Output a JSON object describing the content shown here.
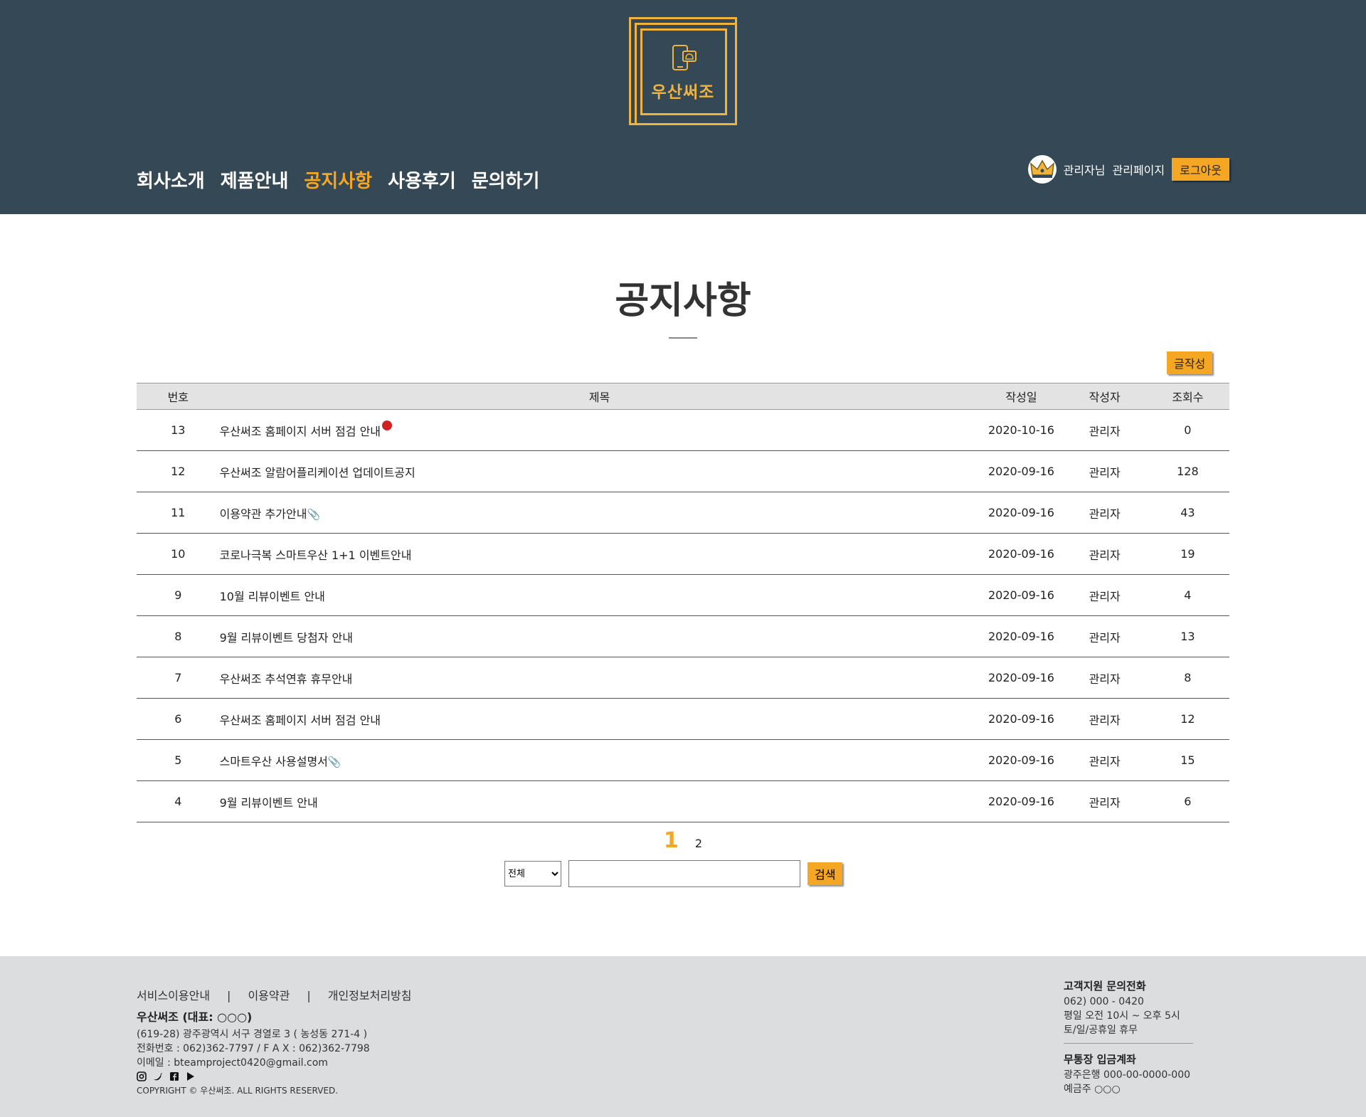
{
  "brand": {
    "name": "우산써조"
  },
  "nav": [
    {
      "label": "회사소개",
      "active": false
    },
    {
      "label": "제품안내",
      "active": false
    },
    {
      "label": "공지사항",
      "active": true
    },
    {
      "label": "사용후기",
      "active": false
    },
    {
      "label": "문의하기",
      "active": false
    }
  ],
  "user": {
    "greeting": "관리자님",
    "admin_link": "관리페이지",
    "logout": "로그아웃"
  },
  "page": {
    "title": "공지사항",
    "write_button": "글작성"
  },
  "table": {
    "headers": [
      "번호",
      "제목",
      "작성일",
      "작성자",
      "조회수"
    ],
    "rows": [
      {
        "no": "13",
        "title": "우산써조 홈페이지 서버 점검 안내",
        "badge": "hot",
        "date": "2020-10-16",
        "author": "관리자",
        "views": "0"
      },
      {
        "no": "12",
        "title": "우산써조 알람어플리케이션 업데이트공지",
        "badge": "",
        "date": "2020-09-16",
        "author": "관리자",
        "views": "128"
      },
      {
        "no": "11",
        "title": "이용약관 추가안내",
        "badge": "attachment",
        "date": "2020-09-16",
        "author": "관리자",
        "views": "43"
      },
      {
        "no": "10",
        "title": "코로나극복 스마트우산 1+1 이벤트안내",
        "badge": "",
        "date": "2020-09-16",
        "author": "관리자",
        "views": "19"
      },
      {
        "no": "9",
        "title": "10월 리뷰이벤트 안내",
        "badge": "",
        "date": "2020-09-16",
        "author": "관리자",
        "views": "4"
      },
      {
        "no": "8",
        "title": "9월 리뷰이벤트 당첨자 안내",
        "badge": "",
        "date": "2020-09-16",
        "author": "관리자",
        "views": "13"
      },
      {
        "no": "7",
        "title": "우산써조 추석연휴 휴무안내",
        "badge": "",
        "date": "2020-09-16",
        "author": "관리자",
        "views": "8"
      },
      {
        "no": "6",
        "title": "우산써조 홈페이지 서버 점검 안내",
        "badge": "",
        "date": "2020-09-16",
        "author": "관리자",
        "views": "12"
      },
      {
        "no": "5",
        "title": "스마트우산 사용설명서",
        "badge": "attachment",
        "date": "2020-09-16",
        "author": "관리자",
        "views": "15"
      },
      {
        "no": "4",
        "title": "9월 리뷰이벤트 안내",
        "badge": "",
        "date": "2020-09-16",
        "author": "관리자",
        "views": "6"
      }
    ]
  },
  "pagination": {
    "current": "1",
    "next": "2"
  },
  "search": {
    "select_value": "전체",
    "input_value": "",
    "button": "검색"
  },
  "footer": {
    "links": [
      "서비스이용안내",
      "이용약관",
      "개인정보처리방침"
    ],
    "separator": "|",
    "company": "우산써조 (대표: ○○○)",
    "address": "(619-28) 광주광역시 서구 경열로 3 ( 농성동 271-4 )",
    "phone_fax": "전화번호 : 062)362-7797 / F A X : 062)362-7798",
    "email": "이메일 : bteamproject0420@gmail.com",
    "social_icons": [
      "instagram-icon",
      "twitter-icon",
      "facebook-icon",
      "google-play-icon"
    ],
    "copyright": "COPYRIGHT © 우산써조. ALL RIGHTS RESERVED.",
    "support": {
      "heading": "고객지원 문의전화",
      "phone": "062) 000 - 0420",
      "hours": "평일 오전 10시 ~ 오후 5시",
      "closed": "토/일/공휴일 휴무"
    },
    "bank": {
      "heading": "무통장 입금계좌",
      "account": "광주은행 000-00-0000-000",
      "holder": "예금주 ○○○"
    }
  },
  "colors": {
    "header_bg": "#354856",
    "accent": "#f5a623",
    "footer_bg": "#dcdddf"
  }
}
